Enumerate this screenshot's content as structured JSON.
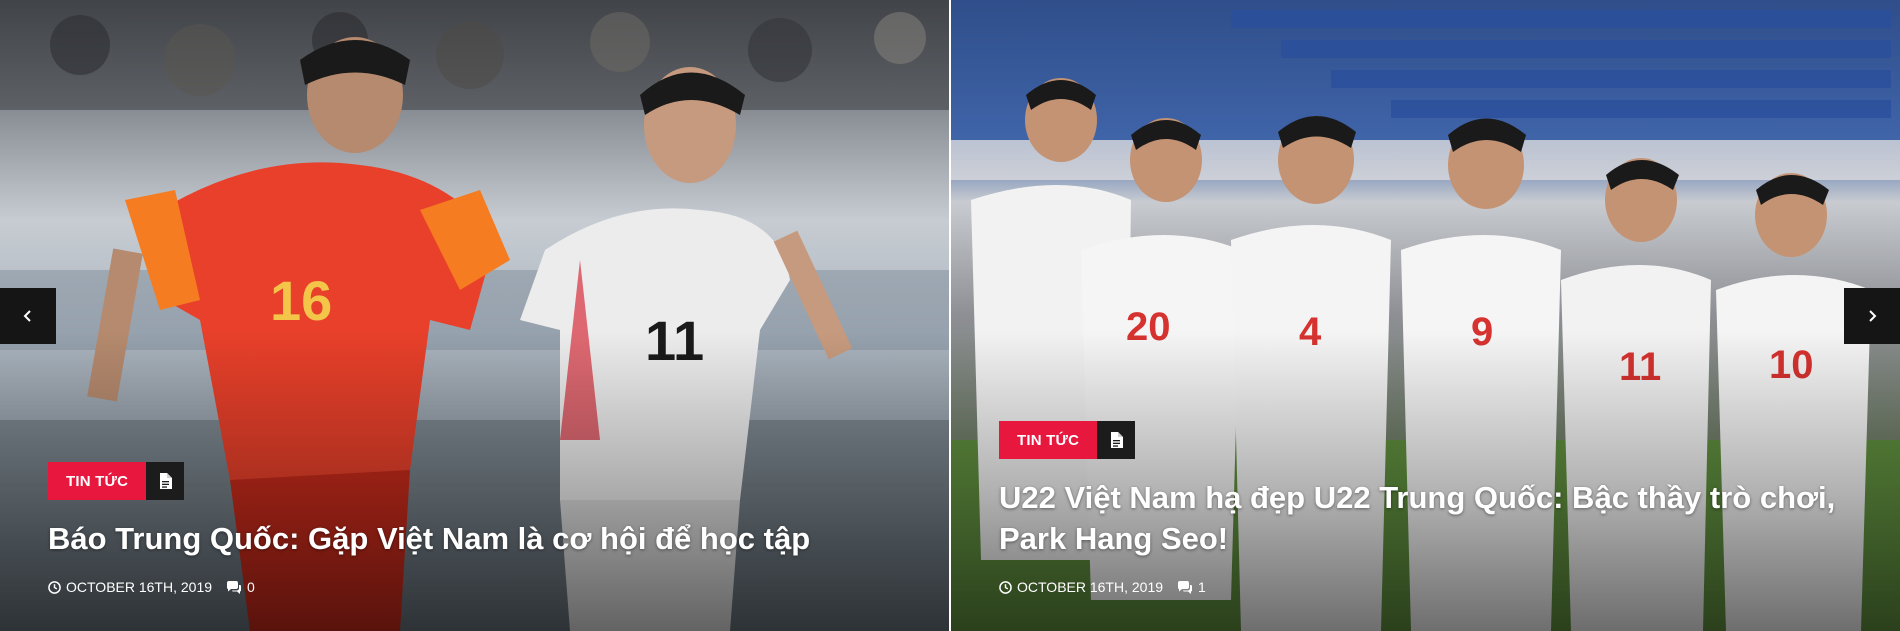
{
  "slider": {
    "prev_icon": "chevron-left-icon",
    "next_icon": "chevron-right-icon",
    "slides": [
      {
        "category": "TIN TỨC",
        "category_icon": "document-icon",
        "title": "Báo Trung Quốc: Gặp Việt Nam là cơ hội để học tập",
        "date": "OCTOBER 16TH, 2019",
        "date_icon": "clock-icon",
        "comments": "0",
        "comments_icon": "comments-icon"
      },
      {
        "category": "TIN TỨC",
        "category_icon": "document-icon",
        "title": "U22 Việt Nam hạ đẹp U22 Trung Quốc: Bậc thầy trò chơi, Park Hang Seo!",
        "date": "OCTOBER 16TH, 2019",
        "date_icon": "clock-icon",
        "comments": "1",
        "comments_icon": "comments-icon"
      }
    ]
  },
  "colors": {
    "badge_red": "#e8173e",
    "badge_dark": "#1c1c1c",
    "nav_dark": "#151515"
  }
}
